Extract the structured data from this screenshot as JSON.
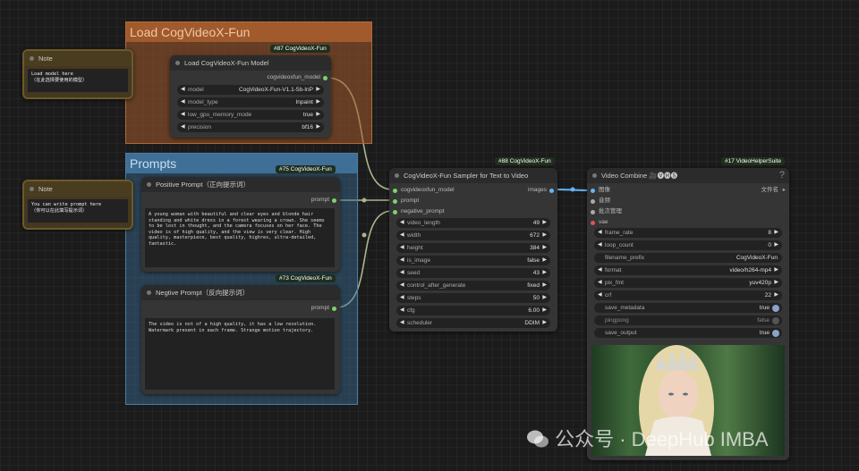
{
  "groups": {
    "load": {
      "title": "Load CogVideoX-Fun",
      "color": "#a05a2c"
    },
    "prompts": {
      "title": "Prompts",
      "color": "#4a7ea6"
    }
  },
  "notes": [
    {
      "title": "Note",
      "text": "Load model here\n（在此选择要使用的模型）"
    },
    {
      "title": "Note",
      "text": "You can write prompt here\n（你可以在此填写提示词）"
    }
  ],
  "load_node": {
    "badge": "#87 CogVideoX-Fun",
    "title": "Load CogVideoX-Fun Model",
    "output": "cogvideoxfun_model",
    "widgets": [
      {
        "label": "model",
        "value": "CogVideoX-Fun-V1.1-5b-InP"
      },
      {
        "label": "model_type",
        "value": "Inpaint"
      },
      {
        "label": "low_gpu_memory_mode",
        "value": "true"
      },
      {
        "label": "precision",
        "value": "bf16"
      }
    ]
  },
  "pos_node": {
    "badge": "#75 CogVideoX-Fun",
    "title": "Positive Prompt（正向提示词）",
    "output": "prompt",
    "text": "A young woman with beautiful and clear eyes and blonde hair standing and white dress in a forest wearing a crown. She seems to be lost in thought, and the camera focuses on her face. The video is of high quality, and the view is very clear. High quality, masterpiece, best quality, highres, ultra-detailed, fantastic."
  },
  "neg_node": {
    "badge": "#73 CogVideoX-Fun",
    "title": "Negtive Prompt（反向提示词）",
    "output": "prompt",
    "text": "The video is not of a high quality, it has a low resolution. Watermark present in each frame. Strange motion trajectory."
  },
  "sampler_node": {
    "badge": "#88 CogVideoX-Fun",
    "title": "CogVideoX-Fun Sampler for Text to Video",
    "inputs": [
      "cogvideoxfun_model",
      "prompt",
      "negative_prompt"
    ],
    "output": "images",
    "widgets": [
      {
        "label": "video_length",
        "value": "49"
      },
      {
        "label": "width",
        "value": "672"
      },
      {
        "label": "height",
        "value": "384"
      },
      {
        "label": "is_image",
        "value": "false"
      },
      {
        "label": "seed",
        "value": "43"
      },
      {
        "label": "control_after_generate",
        "value": "fixed"
      },
      {
        "label": "steps",
        "value": "50"
      },
      {
        "label": "cfg",
        "value": "6.00"
      },
      {
        "label": "scheduler",
        "value": "DDIM"
      }
    ]
  },
  "combine_node": {
    "badge": "#17 VideoHelperSuite",
    "title": "Video Combine 🎥🅥🅗🅢",
    "help": "?",
    "inputs": [
      "图像",
      "音频",
      "批次管理",
      "vae"
    ],
    "output": "文件名",
    "widgets": [
      {
        "label": "frame_rate",
        "value": "8"
      },
      {
        "label": "loop_count",
        "value": "0"
      },
      {
        "label": "filename_prefix",
        "value": "CogVideoX-Fun"
      },
      {
        "label": "format",
        "value": "video/h264-mp4"
      },
      {
        "label": "pix_fmt",
        "value": "yuv420p"
      },
      {
        "label": "crf",
        "value": "22"
      }
    ],
    "toggles": [
      {
        "label": "save_metadata",
        "value": "true",
        "on": true
      },
      {
        "label": "pingpong",
        "value": "false",
        "on": false
      },
      {
        "label": "save_output",
        "value": "true",
        "on": true
      }
    ]
  },
  "watermark": "公众号 · DeepHub IMBA",
  "colors": {
    "link": "#a8b890",
    "image_link": "#64b5f6",
    "port_green": "#7cd36b",
    "port_red": "#e05252"
  }
}
